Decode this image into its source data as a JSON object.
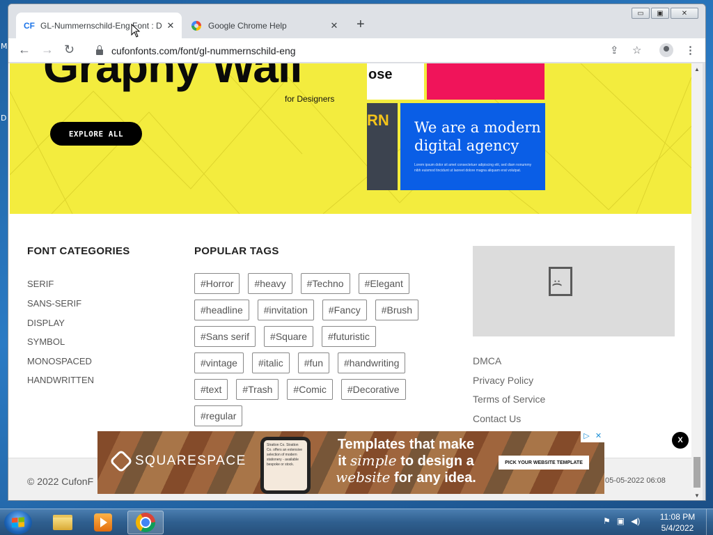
{
  "desktop": {
    "left_letters": [
      "M",
      "D"
    ]
  },
  "browser": {
    "tabs": [
      {
        "favicon": "CF",
        "title": "GL-Nummernschild-Eng Font : D",
        "close": "✕"
      },
      {
        "favicon": "google-g-icon",
        "title": "Google Chrome Help",
        "close": "✕"
      }
    ],
    "new_tab": "+",
    "window_controls": {
      "minimize": "▭",
      "maximize": "▣",
      "close": "✕"
    },
    "url": "cufonfonts.com/font/gl-nummernschild-eng"
  },
  "hero": {
    "title": "Graphy Wall",
    "subtitle": "for Designers",
    "button": "EXPLORE ALL",
    "tile_white_text": "ose",
    "tile_dark_text": "RN",
    "tile_blue_heading": "We are a modern digital agency",
    "tile_blue_body": "Lorem ipsum dolor sit amet consectetuer adipiscing elit, sed diam nonummy nibh euismod tincidunt ut laoreet dolore magna aliquam erat volutpat."
  },
  "categories": {
    "title": "FONT CATEGORIES",
    "items": [
      "SERIF",
      "SANS-SERIF",
      "DISPLAY",
      "SYMBOL",
      "MONOSPACED",
      "HANDWRITTEN"
    ]
  },
  "tags": {
    "title": "POPULAR TAGS",
    "rows": [
      [
        "#Horror",
        "#heavy",
        "#Techno",
        "#Elegant"
      ],
      [
        "#headline",
        "#invitation",
        "#Fancy",
        "#Brush"
      ],
      [
        "#Sans serif",
        "#Square",
        "#futuristic"
      ],
      [
        "#vintage",
        "#italic",
        "#fun",
        "#handwriting"
      ],
      [
        "#text",
        "#Trash",
        "#Comic",
        "#Decorative"
      ],
      [
        "#regular"
      ]
    ]
  },
  "links": [
    "DMCA",
    "Privacy Policy",
    "Terms of Service",
    "Contact Us"
  ],
  "footer": {
    "copyright": "© 2022 CufonF",
    "date": "05-05-2022 06:08"
  },
  "ad": {
    "brand": "SQUARESPACE",
    "headline_1": "Templates that make",
    "headline_2a": "it",
    "headline_2b": "simple",
    "headline_2c": "to design a",
    "headline_3a": "website",
    "headline_3b": "for any idea.",
    "cta": "PICK YOUR WEBSITE TEMPLATE",
    "phone_text": "Stratton Co. Stratton Co. offers an extensive selection of modern stationery - available bespoke or stock.",
    "close": "X"
  },
  "taskbar": {
    "time": "11:08 PM",
    "date": "5/4/2022"
  }
}
